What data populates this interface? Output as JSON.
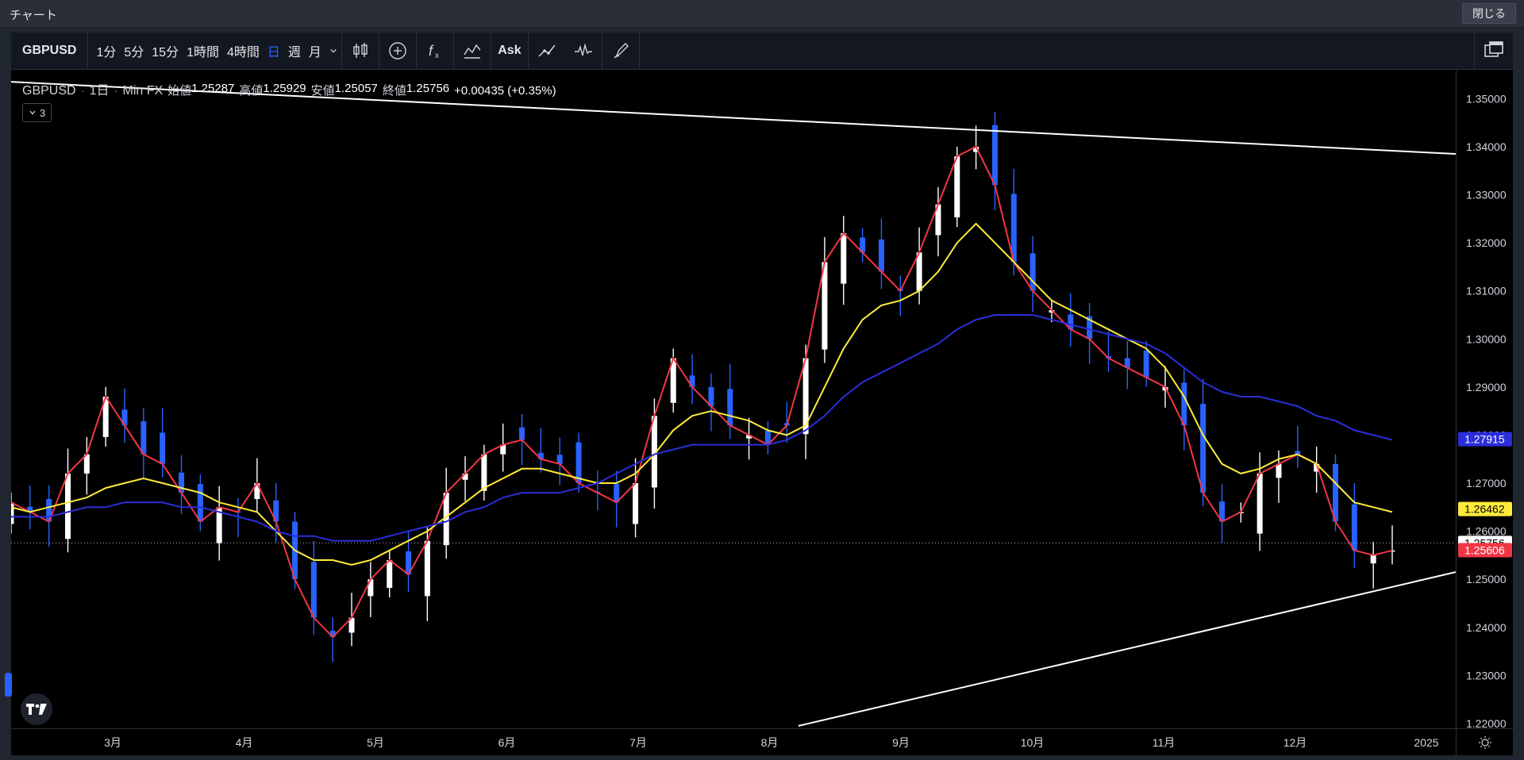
{
  "window": {
    "title": "チャート",
    "close_label": "閉じる"
  },
  "toolbar": {
    "symbol": "GBPUSD",
    "intervals": [
      "1分",
      "5分",
      "15分",
      "1時間",
      "4時間",
      "日",
      "週",
      "月"
    ],
    "active_interval": "日",
    "ask_label": "Ask",
    "icons": [
      "candles-icon",
      "add-icon",
      "indicators-icon",
      "compare-icon",
      "ask-button",
      "trend-icon",
      "wave-icon",
      "brush-icon",
      "layout-icon"
    ]
  },
  "legend": {
    "symbol": "GBPUSD",
    "interval": "1日",
    "source": "Min FX",
    "open_label": "始値",
    "open": "1.25287",
    "high_label": "高値",
    "high": "1.25929",
    "low_label": "安値",
    "low": "1.25057",
    "close_label": "終値",
    "close": "1.25756",
    "change": "+0.00435 (+0.35%)",
    "indicator_count": "3"
  },
  "price_labels": {
    "blue": "1.27915",
    "yellow": "1.26462",
    "last": "1.25756",
    "red": "1.25606"
  },
  "colors": {
    "bull": "#ffffff",
    "bear": "#2962ff",
    "ma_fast": "#f23645",
    "ma_mid": "#ffeb3b",
    "ma_slow": "#2a2ed8",
    "trendline": "#ffffff"
  },
  "chart_data": {
    "type": "line",
    "title": "",
    "y_ticks": [
      "1.35000",
      "1.34000",
      "1.33000",
      "1.32000",
      "1.31000",
      "1.30000",
      "1.29000",
      "1.28000",
      "1.27000",
      "1.26000",
      "1.25000",
      "1.24000",
      "1.23000",
      "1.22000"
    ],
    "ylim": [
      1.219,
      1.356
    ],
    "x_labels": [
      "3月",
      "4月",
      "5月",
      "6月",
      "7月",
      "8月",
      "9月",
      "10月",
      "11月",
      "12月",
      "2025"
    ],
    "series": [
      {
        "values": [
          1.266,
          1.264,
          1.262,
          1.272,
          1.276,
          1.288,
          1.282,
          1.276,
          1.274,
          1.268,
          1.262,
          1.265,
          1.264,
          1.27,
          1.262,
          1.25,
          1.242,
          1.238,
          1.242,
          1.25,
          1.254,
          1.251,
          1.258,
          1.268,
          1.272,
          1.276,
          1.278,
          1.279,
          1.275,
          1.274,
          1.27,
          1.268,
          1.266,
          1.27,
          1.284,
          1.296,
          1.29,
          1.286,
          1.282,
          1.28,
          1.278,
          1.282,
          1.296,
          1.316,
          1.322,
          1.318,
          1.314,
          1.31,
          1.318,
          1.328,
          1.338,
          1.34,
          1.332,
          1.316,
          1.31,
          1.306,
          1.302,
          1.3,
          1.296,
          1.294,
          1.292,
          1.29,
          1.282,
          1.268,
          1.262,
          1.264,
          1.272,
          1.274,
          1.276,
          1.274,
          1.262,
          1.256,
          1.255,
          1.256
        ]
      },
      {
        "values": [
          1.265,
          1.264,
          1.265,
          1.266,
          1.267,
          1.269,
          1.27,
          1.271,
          1.27,
          1.269,
          1.268,
          1.266,
          1.265,
          1.264,
          1.26,
          1.256,
          1.254,
          1.254,
          1.253,
          1.254,
          1.256,
          1.258,
          1.26,
          1.263,
          1.266,
          1.269,
          1.271,
          1.273,
          1.273,
          1.272,
          1.271,
          1.27,
          1.27,
          1.272,
          1.276,
          1.281,
          1.284,
          1.285,
          1.284,
          1.283,
          1.281,
          1.28,
          1.282,
          1.29,
          1.298,
          1.304,
          1.307,
          1.308,
          1.31,
          1.314,
          1.32,
          1.324,
          1.32,
          1.316,
          1.312,
          1.308,
          1.306,
          1.304,
          1.302,
          1.3,
          1.298,
          1.294,
          1.288,
          1.28,
          1.274,
          1.272,
          1.273,
          1.275,
          1.276,
          1.274,
          1.27,
          1.266,
          1.265,
          1.264
        ]
      },
      {
        "values": [
          1.263,
          1.263,
          1.263,
          1.264,
          1.265,
          1.265,
          1.266,
          1.266,
          1.266,
          1.265,
          1.265,
          1.264,
          1.263,
          1.262,
          1.26,
          1.259,
          1.259,
          1.258,
          1.258,
          1.258,
          1.259,
          1.26,
          1.261,
          1.262,
          1.264,
          1.265,
          1.267,
          1.268,
          1.268,
          1.268,
          1.269,
          1.27,
          1.272,
          1.274,
          1.276,
          1.277,
          1.278,
          1.278,
          1.278,
          1.278,
          1.278,
          1.279,
          1.281,
          1.284,
          1.288,
          1.291,
          1.293,
          1.295,
          1.297,
          1.299,
          1.302,
          1.304,
          1.305,
          1.305,
          1.305,
          1.304,
          1.303,
          1.302,
          1.301,
          1.3,
          1.299,
          1.297,
          1.294,
          1.291,
          1.289,
          1.288,
          1.288,
          1.287,
          1.286,
          1.284,
          1.283,
          1.281,
          1.28,
          1.279
        ]
      }
    ],
    "trendlines": [
      {
        "from": [
          0.0,
          1.3535
        ],
        "to": [
          1.0,
          1.3385
        ]
      },
      {
        "from": [
          0.545,
          1.2195
        ],
        "to": [
          1.0,
          1.2515
        ]
      }
    ],
    "grid": false,
    "legend_position": "top-left"
  }
}
